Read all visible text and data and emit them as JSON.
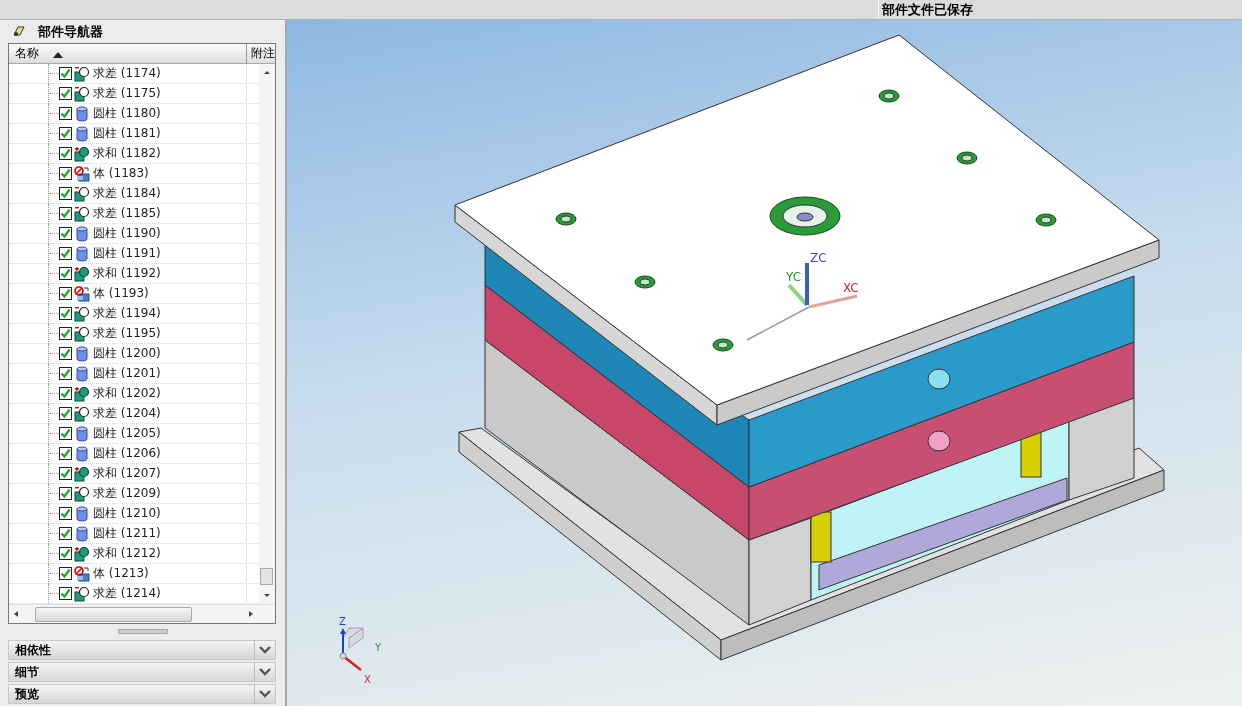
{
  "status_bar": {
    "message": "部件文件已保存"
  },
  "navigator": {
    "title": "部件导航器",
    "columns": [
      "名称",
      "附注"
    ],
    "rows": [
      {
        "kind": "subtract",
        "label": "求差 (1174)",
        "checked": true
      },
      {
        "kind": "subtract",
        "label": "求差 (1175)",
        "checked": true
      },
      {
        "kind": "cylinder",
        "label": "圆柱 (1180)",
        "checked": true
      },
      {
        "kind": "cylinder",
        "label": "圆柱 (1181)",
        "checked": true
      },
      {
        "kind": "unite",
        "label": "求和 (1182)",
        "checked": true
      },
      {
        "kind": "body",
        "label": "体 (1183)",
        "checked": true
      },
      {
        "kind": "subtract",
        "label": "求差 (1184)",
        "checked": true
      },
      {
        "kind": "subtract",
        "label": "求差 (1185)",
        "checked": true
      },
      {
        "kind": "cylinder",
        "label": "圆柱 (1190)",
        "checked": true
      },
      {
        "kind": "cylinder",
        "label": "圆柱 (1191)",
        "checked": true
      },
      {
        "kind": "unite",
        "label": "求和 (1192)",
        "checked": true
      },
      {
        "kind": "body",
        "label": "体 (1193)",
        "checked": true
      },
      {
        "kind": "subtract",
        "label": "求差 (1194)",
        "checked": true
      },
      {
        "kind": "subtract",
        "label": "求差 (1195)",
        "checked": true
      },
      {
        "kind": "cylinder",
        "label": "圆柱 (1200)",
        "checked": true
      },
      {
        "kind": "cylinder",
        "label": "圆柱 (1201)",
        "checked": true
      },
      {
        "kind": "unite",
        "label": "求和 (1202)",
        "checked": true
      },
      {
        "kind": "subtract",
        "label": "求差 (1204)",
        "checked": true
      },
      {
        "kind": "cylinder",
        "label": "圆柱 (1205)",
        "checked": true
      },
      {
        "kind": "cylinder",
        "label": "圆柱 (1206)",
        "checked": true
      },
      {
        "kind": "unite",
        "label": "求和 (1207)",
        "checked": true
      },
      {
        "kind": "subtract",
        "label": "求差 (1209)",
        "checked": true
      },
      {
        "kind": "cylinder",
        "label": "圆柱 (1210)",
        "checked": true
      },
      {
        "kind": "cylinder",
        "label": "圆柱 (1211)",
        "checked": true
      },
      {
        "kind": "unite",
        "label": "求和 (1212)",
        "checked": true
      },
      {
        "kind": "body",
        "label": "体 (1213)",
        "checked": true
      },
      {
        "kind": "subtract",
        "label": "求差 (1214)",
        "checked": true
      }
    ]
  },
  "sections": [
    {
      "label": "相依性",
      "expanded": false
    },
    {
      "label": "细节",
      "expanded": false
    },
    {
      "label": "预览",
      "expanded": false
    }
  ],
  "viewport": {
    "axis_labels": [
      "XC",
      "YC",
      "ZC"
    ],
    "triad_labels": [
      "X",
      "Y",
      "Z"
    ]
  }
}
